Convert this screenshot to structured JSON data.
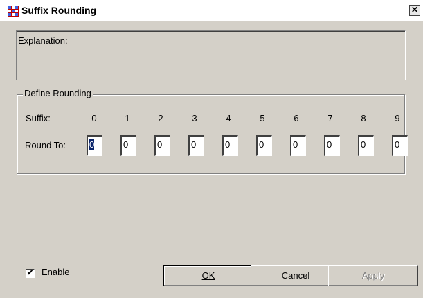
{
  "window": {
    "title": "Suffix Rounding",
    "close_glyph": "✕"
  },
  "explanation": {
    "label": "Explanation:"
  },
  "rounding": {
    "group_title": "Define Rounding",
    "suffix_label": "Suffix:",
    "round_to_label": "Round To:",
    "suffixes": [
      "0",
      "1",
      "2",
      "3",
      "4",
      "5",
      "6",
      "7",
      "8",
      "9"
    ],
    "values": [
      "0",
      "0",
      "0",
      "0",
      "0",
      "0",
      "0",
      "0",
      "0",
      "0"
    ]
  },
  "enable": {
    "label": "Enable",
    "checked": true
  },
  "buttons": {
    "ok": "OK",
    "cancel": "Cancel",
    "apply": "Apply"
  }
}
